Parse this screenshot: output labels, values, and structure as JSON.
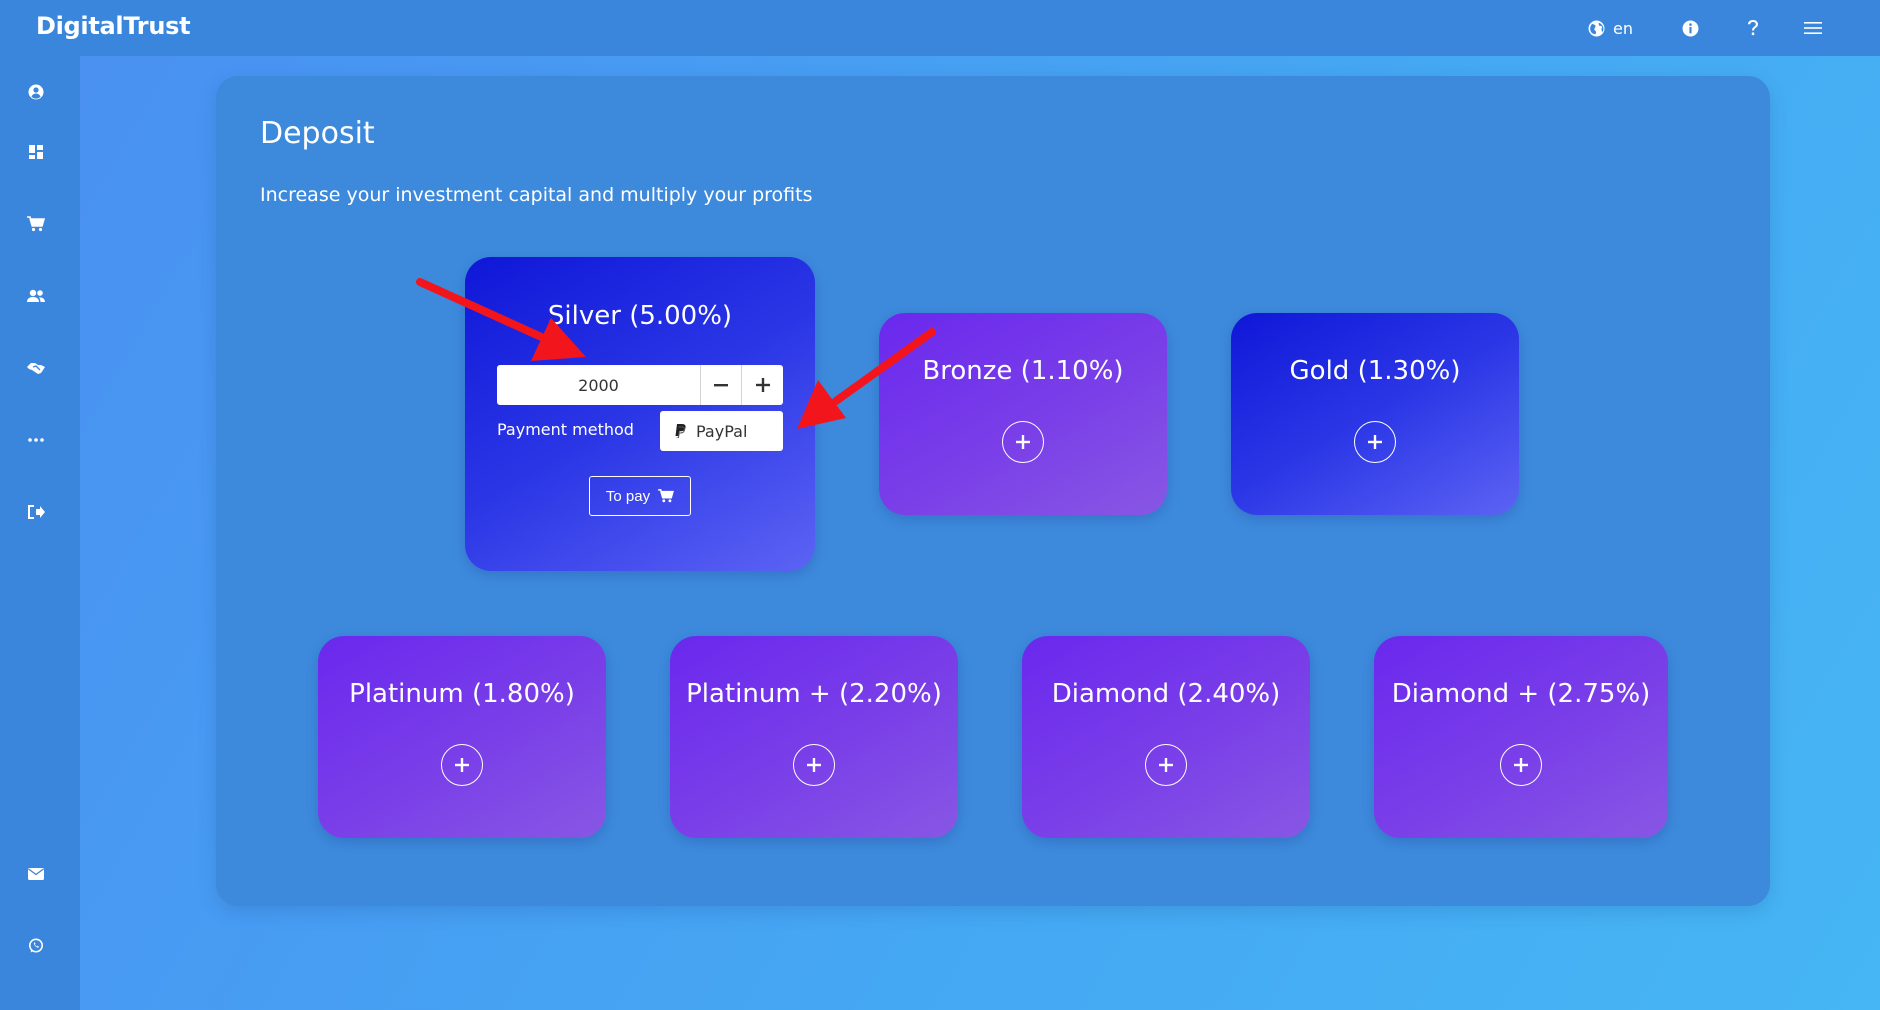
{
  "app": {
    "brand": "DigitalTrust"
  },
  "topbar": {
    "language": "en"
  },
  "sidebar": {
    "items": [
      {
        "icon": "user-icon"
      },
      {
        "icon": "dashboard-icon"
      },
      {
        "icon": "cart-icon"
      },
      {
        "icon": "users-icon"
      },
      {
        "icon": "handshake-icon"
      },
      {
        "icon": "more-icon"
      },
      {
        "icon": "logout-icon"
      },
      {
        "icon": "mail-icon"
      },
      {
        "icon": "whatsapp-icon"
      }
    ]
  },
  "deposit": {
    "title": "Deposit",
    "subtitle": "Increase your investment capital and multiply your profits",
    "active_plan": {
      "title": "Silver (5.00%)",
      "amount": "2000",
      "payment_label": "Payment method",
      "payment_method": "PayPal",
      "pay_label": "To pay"
    },
    "plans": [
      {
        "title": "Bronze (1.10%)"
      },
      {
        "title": "Gold (1.30%)"
      },
      {
        "title": "Platinum (1.80%)"
      },
      {
        "title": "Platinum + (2.20%)"
      },
      {
        "title": "Diamond (2.40%)"
      },
      {
        "title": "Diamond + (2.75%)"
      }
    ]
  },
  "colors": {
    "background": "#46a4f3",
    "bar": "#3a86dc",
    "panel": "#3d8adc",
    "plan_purple": "#7a3fe8",
    "plan_blue": "#2b37e6",
    "annotation_arrow": "#f2151c"
  }
}
